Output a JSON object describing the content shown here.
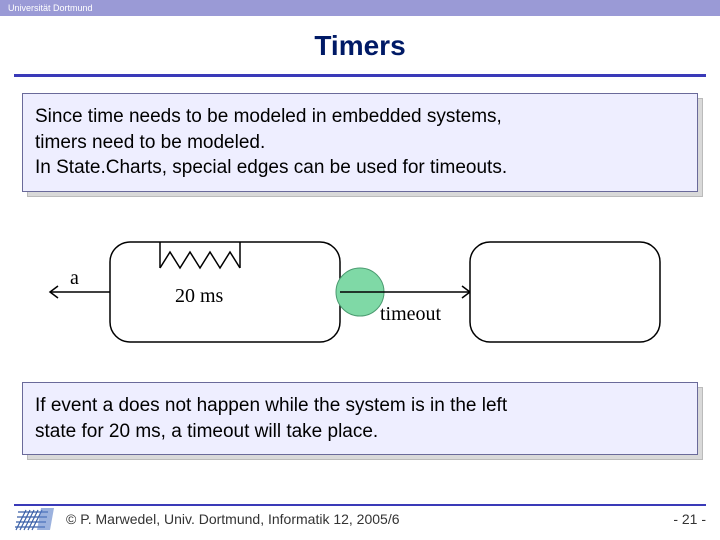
{
  "header": {
    "institution": "Universität Dortmund"
  },
  "title": "Timers",
  "box1": {
    "line1": "Since time needs to be modeled in embedded systems,",
    "line2": "timers need to be modeled.",
    "line3": "In State.Charts, special edges can be used for timeouts."
  },
  "diagram": {
    "label_a": "a",
    "label_20ms": "20 ms",
    "label_timeout": "timeout"
  },
  "box2": {
    "line1": "If event a does not happen while the system is in the left",
    "line2": "state for 20 ms, a timeout will take place."
  },
  "footer": {
    "copyright": "© P. Marwedel, Univ. Dortmund, Informatik 12, 2005/6",
    "page": "-  21 -"
  }
}
